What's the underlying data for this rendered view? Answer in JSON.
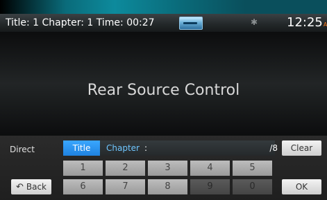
{
  "status": {
    "info": "Title: 1  Chapter: 1  Time: 00:27",
    "time": "12:25",
    "ampm": "AM"
  },
  "main": {
    "heading": "Rear Source Control"
  },
  "direct": {
    "label": "Direct",
    "title_tab": "Title",
    "chapter_label": "Chapter",
    "colon": ":",
    "total": "/8",
    "clear_label": "Clear"
  },
  "keypad": {
    "row1": [
      "1",
      "2",
      "3",
      "4",
      "5"
    ],
    "row2": [
      "6",
      "7",
      "8",
      "9",
      "0"
    ],
    "disabled_keys": [
      "9",
      "0"
    ]
  },
  "buttons": {
    "back_label": "Back",
    "ok_label": "OK"
  },
  "icons": {
    "disc": "disc-icon",
    "bluetooth": "bluetooth-icon",
    "back": "back-arrow-icon"
  }
}
